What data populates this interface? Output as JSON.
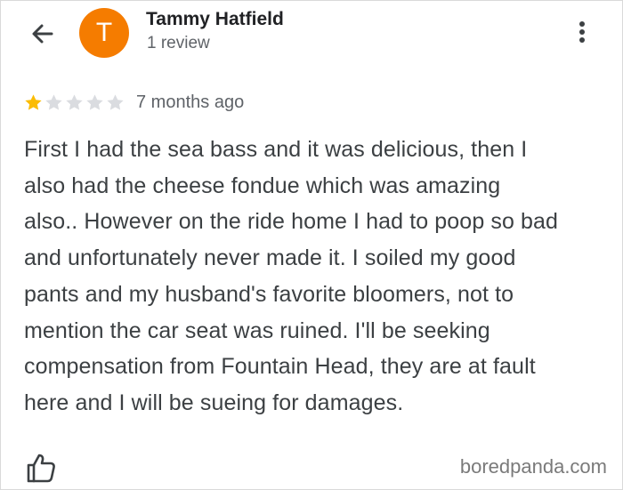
{
  "reviewer": {
    "avatar_letter": "T",
    "avatar_color": "#f57c00",
    "name": "Tammy Hatfield",
    "review_count": "1 review"
  },
  "icons": {
    "back": "arrow-back-icon",
    "more": "more-vert-icon",
    "like": "thumbs-up-icon"
  },
  "review": {
    "rating": 1,
    "max_rating": 5,
    "star_filled_color": "#fbbc04",
    "star_empty_color": "#dadce0",
    "time_ago": "7 months ago",
    "lines": [
      "First I had the sea bass and it was delicious, then I",
      "also had the cheese fondue which was amazing",
      "also.. However on the ride home I had to poop so bad",
      "and unfortunately never made it. I soiled my good",
      "pants and my husband's favorite bloomers, not to",
      "mention the car seat was ruined. I'll be seeking",
      "compensation from Fountain Head, they are at fault",
      "here and I will be sueing for damages."
    ]
  },
  "watermark": "boredpanda.com"
}
